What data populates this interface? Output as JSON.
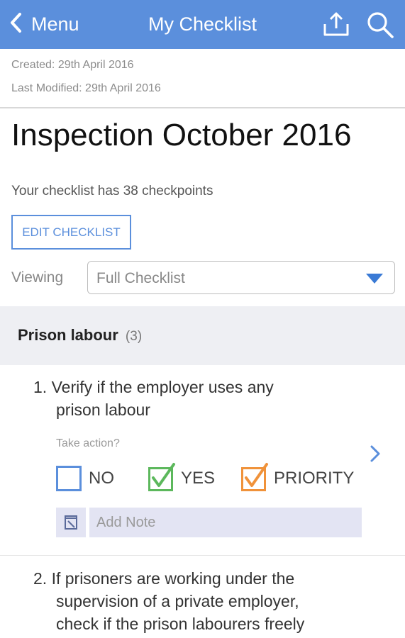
{
  "appbar": {
    "back_label": "Menu",
    "title": "My Checklist",
    "share_icon": "share-upload-icon",
    "search_icon": "search-icon",
    "color": "#5b8fdc"
  },
  "meta": {
    "created": "Created: 29th April 2016",
    "modified": "Last Modified: 29th April 2016"
  },
  "checklist": {
    "title": "Inspection October 2016",
    "count_text": "Your checklist has 38 checkpoints",
    "edit_label": "EDIT CHECKLIST",
    "viewing_label": "Viewing",
    "viewing_value": "Full Checklist"
  },
  "section": {
    "title": "Prison labour",
    "count": "(3)"
  },
  "checkpoints": [
    {
      "number": "1.",
      "line1": "Verify if the employer uses any",
      "line2": "prison labour",
      "take_action": "Take action?",
      "options": [
        {
          "label": "NO",
          "checked": false,
          "color": "#5b8fdc"
        },
        {
          "label": "YES",
          "checked": true,
          "color": "#5cb85c"
        },
        {
          "label": "PRIORITY",
          "checked": true,
          "color": "#f0923a"
        }
      ],
      "note_placeholder": "Add Note"
    },
    {
      "number": "2.",
      "line1": "If prisoners are working under the",
      "line2": "supervision of a private employer,",
      "line3": "check if the prison labourers freely"
    }
  ]
}
